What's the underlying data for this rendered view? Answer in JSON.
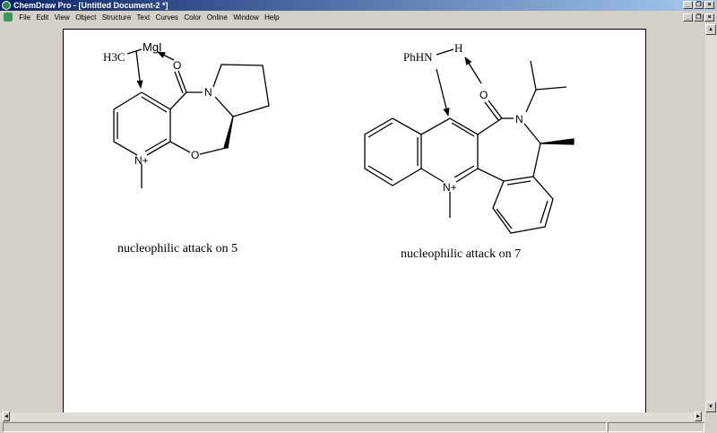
{
  "window": {
    "title": "ChemDraw Pro - [Untitled Document-2 *]",
    "minimize": "_",
    "restore": "❐",
    "close": "×"
  },
  "menu": [
    "File",
    "Edit",
    "View",
    "Object",
    "Structure",
    "Text",
    "Curves",
    "Color",
    "Online",
    "Window",
    "Help"
  ],
  "scheme1": {
    "caption": "nucleophilic attack on 5",
    "labels": {
      "methyl": "H3C",
      "reagent": "MgI",
      "carbonyl_o": "O",
      "amide_n": "N",
      "ring_o": "O",
      "pyridinium_n": "N+"
    }
  },
  "scheme2": {
    "caption": "nucleophilic attack on 7",
    "labels": {
      "nucleophile": "PhHN",
      "hydrogen": "H",
      "carbonyl_o": "O",
      "amide_n": "N",
      "acridinium_n": "N+"
    }
  },
  "scroll": {
    "up": "▲",
    "down": "▼",
    "left": "◄",
    "right": "►"
  }
}
